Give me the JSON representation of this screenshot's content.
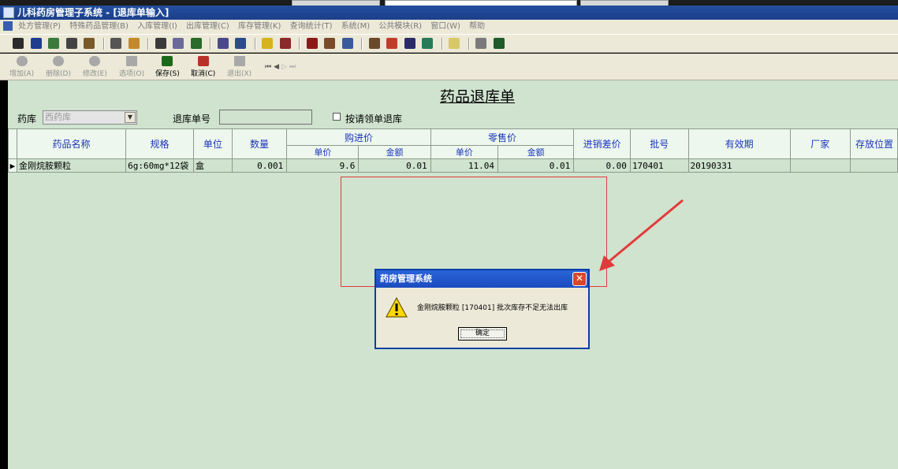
{
  "window": {
    "title": "儿科药房管理子系统 - [退库单输入]"
  },
  "menu": [
    "处方管理(P)",
    "特殊药品管理(B)",
    "入库管理(I)",
    "出库管理(C)",
    "库存管理(K)",
    "查询统计(T)",
    "系统(M)",
    "公共模块(R)",
    "窗口(W)",
    "帮助"
  ],
  "toolbar_buttons": {
    "add": "增加(A)",
    "delete": "册除(D)",
    "edit": "修改(E)",
    "options": "选项(O)",
    "save": "保存(S)",
    "cancel": "取消(C)",
    "exit": "退出(X)"
  },
  "form": {
    "title": "药品退库单",
    "pharmacy_label": "药库",
    "pharmacy_value": "西药库",
    "doc_no_label": "退库单号",
    "by_request_label": "按请领单退库"
  },
  "grid": {
    "headers": {
      "name": "药品名称",
      "spec": "规格",
      "unit": "单位",
      "qty": "数量",
      "purchase": "购进价",
      "retail": "零售价",
      "price": "单价",
      "amount": "金额",
      "diff": "进销差价",
      "batch": "批号",
      "expiry": "有效期",
      "maker": "厂家",
      "location": "存放位置"
    },
    "rows": [
      {
        "name": "金刚烷胺颗粒",
        "spec": "6g:60mg*12袋",
        "unit": "盒",
        "qty": "0.001",
        "p_price": "9.6",
        "p_amount": "0.01",
        "r_price": "11.04",
        "r_amount": "0.01",
        "diff": "0.00",
        "batch": "170401",
        "expiry": "20190331",
        "maker": "",
        "location": ""
      }
    ]
  },
  "dialog": {
    "title": "药房管理系统",
    "message": "金刚烷胺颗粒 [170401] 批次库存不足无法出库",
    "ok": "确定",
    "close": "✕"
  },
  "colors": {
    "background": "#cfe3cf",
    "header_text": "#1a36b8",
    "annotation": "#e23a3a"
  }
}
